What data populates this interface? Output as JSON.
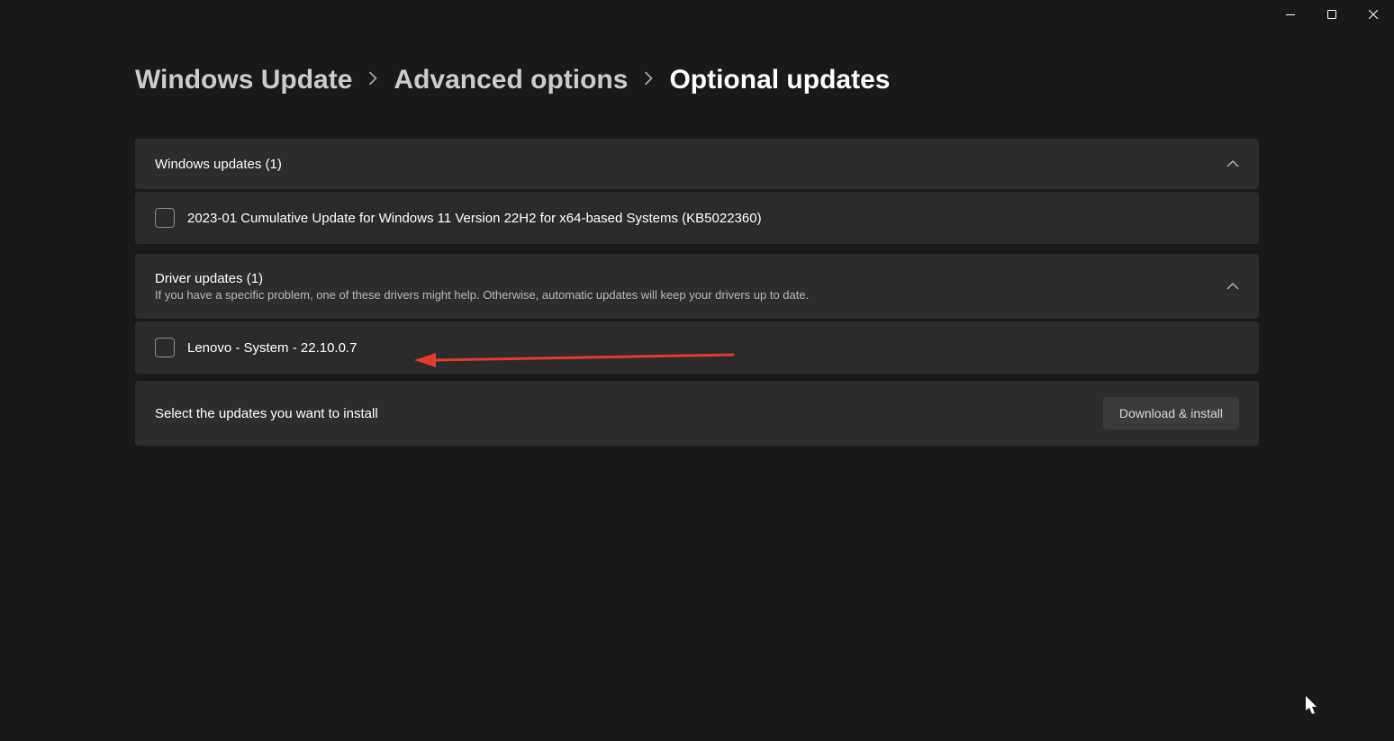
{
  "breadcrumb": {
    "item1": "Windows Update",
    "item2": "Advanced options",
    "item3": "Optional updates"
  },
  "sections": {
    "windows": {
      "title": "Windows updates (1)",
      "items": [
        {
          "label": "2023-01 Cumulative Update for Windows 11 Version 22H2 for x64-based Systems (KB5022360)"
        }
      ]
    },
    "drivers": {
      "title": "Driver updates (1)",
      "subtitle": "If you have a specific problem, one of these drivers might help. Otherwise, automatic updates will keep your drivers up to date.",
      "items": [
        {
          "label": "Lenovo - System - 22.10.0.7"
        }
      ]
    }
  },
  "footer": {
    "prompt": "Select the updates you want to install",
    "button": "Download & install"
  }
}
